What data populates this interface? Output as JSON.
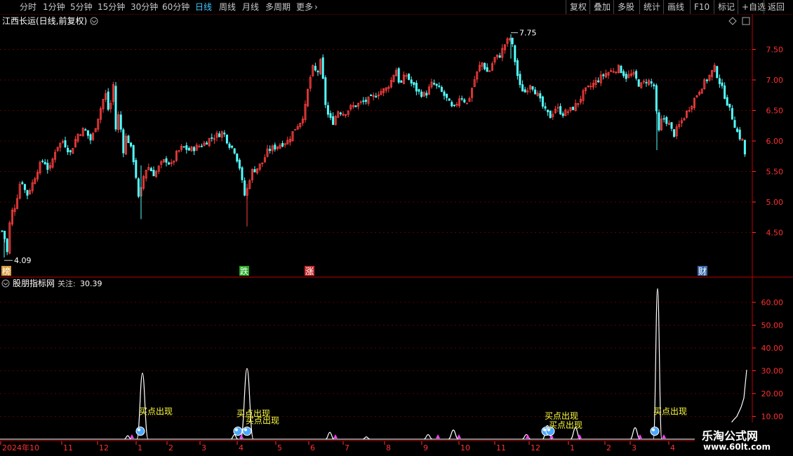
{
  "toolbar": {
    "periods": [
      "分时",
      "1分钟",
      "5分钟",
      "15分钟",
      "30分钟",
      "60分钟",
      "日线",
      "周线",
      "月线",
      "多周期",
      "更多"
    ],
    "active_period": "日线",
    "more_icon": "chevron-right-icon",
    "right_buttons": [
      "复权",
      "叠加",
      "多股",
      "统计",
      "画线",
      "F10",
      "标记",
      "+自选",
      "返回"
    ]
  },
  "main_panel": {
    "title": "江西长运(日线,前复权)",
    "title_icon": "chevron-down-circle-icon",
    "high_label": "7.75",
    "low_label": "4.09",
    "right_icons": [
      "diamond-icon",
      "square-icon"
    ],
    "y_ticks": [
      "7.50",
      "7.00",
      "6.50",
      "6.00",
      "5.50",
      "5.00",
      "4.50"
    ],
    "event_tags": [
      {
        "text": "榜",
        "color": "#d89a3c"
      },
      {
        "text": "跌",
        "color": "#22a822"
      },
      {
        "text": "涨",
        "color": "#c83030"
      },
      {
        "text": "财",
        "color": "#3a6aa8"
      }
    ]
  },
  "indicator_panel": {
    "name": "股朋指标网",
    "focus_label": "关注:",
    "focus_value": "30.39",
    "name_icon": "chevron-down-circle-icon",
    "y_ticks": [
      "60.00",
      "50.00",
      "40.00",
      "30.00",
      "20.00",
      "10.00"
    ],
    "signal_text": "买点出现"
  },
  "time_axis": {
    "labels": [
      "2024年10",
      "11",
      "12",
      "1",
      "2",
      "3",
      "4",
      "5",
      "6",
      "7",
      "8",
      "9",
      "10",
      "11",
      "12",
      "1",
      "2",
      "3",
      "4"
    ]
  },
  "colors": {
    "up": "#ff4040",
    "down": "#54ffff",
    "grid": "#7a0000",
    "axis_text": "#ff3030",
    "signal": "#ffff40",
    "marker": "#ff40ff",
    "ball": "#4aa8ff"
  },
  "chart_data": {
    "type": "candlestick",
    "title": "江西长运(日线,前复权)",
    "xlabel": "",
    "ylabel": "",
    "ylim": [
      4.0,
      7.85
    ],
    "x_start": "2024年10",
    "close_path": [
      [
        0,
        4.3
      ],
      [
        4,
        4.6
      ],
      [
        10,
        4.15
      ],
      [
        15,
        4.8
      ],
      [
        22,
        4.95
      ],
      [
        30,
        5.4
      ],
      [
        38,
        5.1
      ],
      [
        46,
        5.3
      ],
      [
        54,
        5.55
      ],
      [
        62,
        5.7
      ],
      [
        70,
        5.5
      ],
      [
        80,
        5.9
      ],
      [
        90,
        6.0
      ],
      [
        100,
        5.8
      ],
      [
        110,
        6.1
      ],
      [
        120,
        6.2
      ],
      [
        130,
        6.0
      ],
      [
        140,
        6.4
      ],
      [
        150,
        6.8
      ],
      [
        156,
        6.4
      ],
      [
        161,
        7.0
      ],
      [
        165,
        6.2
      ],
      [
        170,
        6.5
      ],
      [
        175,
        5.8
      ],
      [
        180,
        6.1
      ],
      [
        186,
        5.9
      ],
      [
        192,
        5.6
      ],
      [
        198,
        5.0
      ],
      [
        204,
        5.4
      ],
      [
        210,
        5.6
      ],
      [
        220,
        5.45
      ],
      [
        228,
        5.6
      ],
      [
        236,
        5.7
      ],
      [
        244,
        5.6
      ],
      [
        252,
        5.8
      ],
      [
        260,
        5.9
      ],
      [
        270,
        5.85
      ],
      [
        280,
        5.9
      ],
      [
        290,
        5.95
      ],
      [
        300,
        6.05
      ],
      [
        310,
        6.1
      ],
      [
        318,
        6.15
      ],
      [
        326,
        5.95
      ],
      [
        334,
        5.85
      ],
      [
        342,
        5.55
      ],
      [
        348,
        5.1
      ],
      [
        352,
        5.2
      ],
      [
        358,
        5.5
      ],
      [
        366,
        5.55
      ],
      [
        374,
        5.65
      ],
      [
        382,
        5.85
      ],
      [
        392,
        5.9
      ],
      [
        400,
        5.95
      ],
      [
        410,
        6.0
      ],
      [
        420,
        6.2
      ],
      [
        430,
        6.35
      ],
      [
        436,
        6.6
      ],
      [
        440,
        6.95
      ],
      [
        446,
        7.2
      ],
      [
        452,
        7.1
      ],
      [
        458,
        7.35
      ],
      [
        462,
        6.7
      ],
      [
        468,
        6.4
      ],
      [
        474,
        6.3
      ],
      [
        482,
        6.5
      ],
      [
        490,
        6.45
      ],
      [
        500,
        6.55
      ],
      [
        510,
        6.6
      ],
      [
        520,
        6.65
      ],
      [
        530,
        6.7
      ],
      [
        540,
        6.8
      ],
      [
        550,
        6.85
      ],
      [
        558,
        7.0
      ],
      [
        564,
        7.2
      ],
      [
        570,
        6.9
      ],
      [
        578,
        7.1
      ],
      [
        586,
        6.95
      ],
      [
        596,
        6.8
      ],
      [
        606,
        6.75
      ],
      [
        616,
        6.95
      ],
      [
        626,
        6.85
      ],
      [
        636,
        6.7
      ],
      [
        646,
        6.5
      ],
      [
        656,
        6.75
      ],
      [
        666,
        6.6
      ],
      [
        676,
        7.0
      ],
      [
        686,
        7.3
      ],
      [
        696,
        7.1
      ],
      [
        704,
        7.35
      ],
      [
        712,
        7.4
      ],
      [
        720,
        7.6
      ],
      [
        728,
        7.7
      ],
      [
        734,
        7.3
      ],
      [
        740,
        6.9
      ],
      [
        748,
        6.8
      ],
      [
        756,
        6.95
      ],
      [
        766,
        6.75
      ],
      [
        776,
        6.5
      ],
      [
        784,
        6.4
      ],
      [
        792,
        6.55
      ],
      [
        802,
        6.45
      ],
      [
        812,
        6.5
      ],
      [
        822,
        6.6
      ],
      [
        832,
        6.8
      ],
      [
        842,
        6.9
      ],
      [
        852,
        7.0
      ],
      [
        862,
        7.1
      ],
      [
        872,
        7.15
      ],
      [
        882,
        7.2
      ],
      [
        892,
        7.05
      ],
      [
        902,
        7.1
      ],
      [
        912,
        6.9
      ],
      [
        922,
        7.0
      ],
      [
        932,
        6.9
      ],
      [
        938,
        6.1
      ],
      [
        944,
        6.4
      ],
      [
        952,
        6.3
      ],
      [
        960,
        6.1
      ],
      [
        970,
        6.3
      ],
      [
        980,
        6.5
      ],
      [
        990,
        6.7
      ],
      [
        1000,
        6.9
      ],
      [
        1010,
        7.05
      ],
      [
        1018,
        7.2
      ],
      [
        1026,
        6.95
      ],
      [
        1034,
        6.7
      ],
      [
        1040,
        6.5
      ],
      [
        1046,
        6.3
      ],
      [
        1052,
        6.1
      ],
      [
        1058,
        6.0
      ],
      [
        1062,
        5.75
      ]
    ],
    "indicator": {
      "name": "股朋指标网",
      "last_value": 30.39,
      "ylim": [
        0,
        68
      ],
      "baseline": 0,
      "spikes": [
        {
          "x": 182,
          "height": 1.5,
          "width": 10
        },
        {
          "x": 203,
          "height": 29,
          "width": 16
        },
        {
          "x": 334,
          "height": 2,
          "width": 10
        },
        {
          "x": 352,
          "height": 31,
          "width": 18
        },
        {
          "x": 470,
          "height": 3,
          "width": 12
        },
        {
          "x": 522,
          "height": 1,
          "width": 10
        },
        {
          "x": 610,
          "height": 2,
          "width": 12
        },
        {
          "x": 646,
          "height": 4,
          "width": 14
        },
        {
          "x": 750,
          "height": 2,
          "width": 12
        },
        {
          "x": 780,
          "height": 6,
          "width": 14
        },
        {
          "x": 820,
          "height": 5,
          "width": 14
        },
        {
          "x": 905,
          "height": 5,
          "width": 14
        },
        {
          "x": 937,
          "height": 66,
          "width": 12
        }
      ],
      "tail": [
        [
          1030,
          0
        ],
        [
          1036,
          4
        ],
        [
          1044,
          8
        ],
        [
          1050,
          10
        ],
        [
          1056,
          14
        ],
        [
          1060,
          18
        ],
        [
          1064,
          30.39
        ]
      ],
      "buy_signals": [
        {
          "x": 200,
          "label_y": 11
        },
        {
          "x": 339,
          "label_y": 10
        },
        {
          "x": 352,
          "label_y": 7
        },
        {
          "x": 778,
          "label_y": 9
        },
        {
          "x": 784,
          "label_y": 5
        },
        {
          "x": 933,
          "label_y": 11
        }
      ],
      "markers": [
        188,
        344,
        478,
        624,
        654,
        752,
        786,
        826,
        912,
        946
      ]
    }
  }
}
